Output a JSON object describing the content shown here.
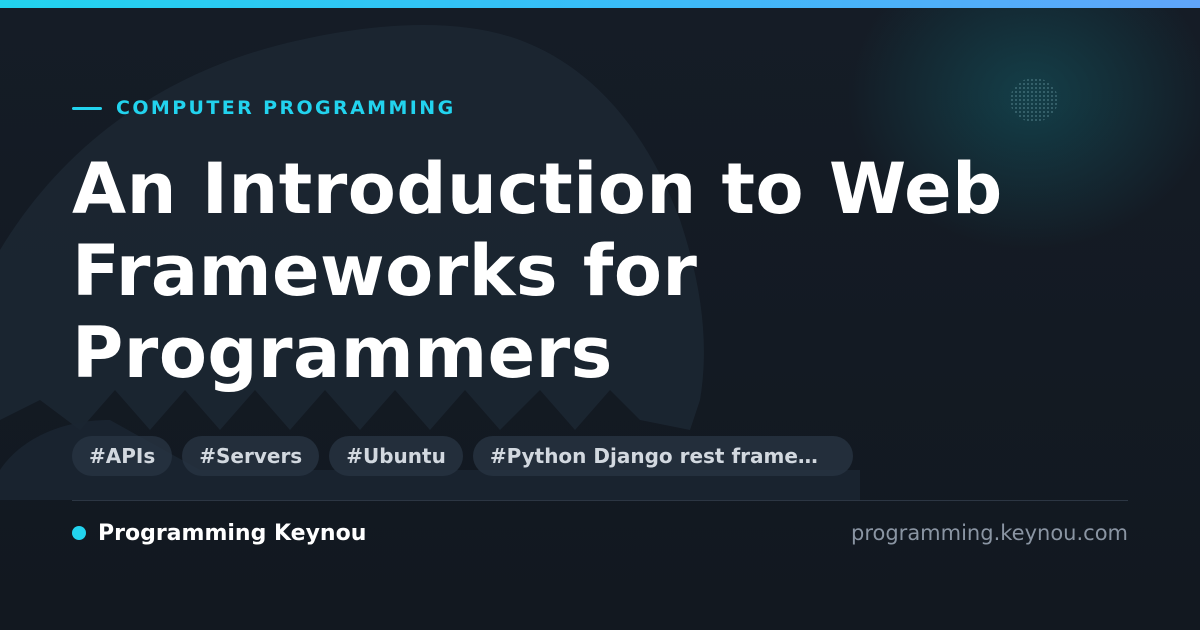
{
  "kicker": "COMPUTER PROGRAMMING",
  "title": {
    "line1": "An Introduction to Web",
    "line2": "Frameworks for",
    "line3": "Programmers"
  },
  "tags": [
    "#APIs",
    "#Servers",
    "#Ubuntu",
    "#Python Django rest framework"
  ],
  "brand": {
    "name": "Programming Keynou",
    "url": "programming.keynou.com"
  },
  "colors": {
    "accent": "#22d3ee",
    "background": "#141b24",
    "title": "#ffffff",
    "tag_text": "#d2d8df",
    "muted": "#8a95a3"
  }
}
